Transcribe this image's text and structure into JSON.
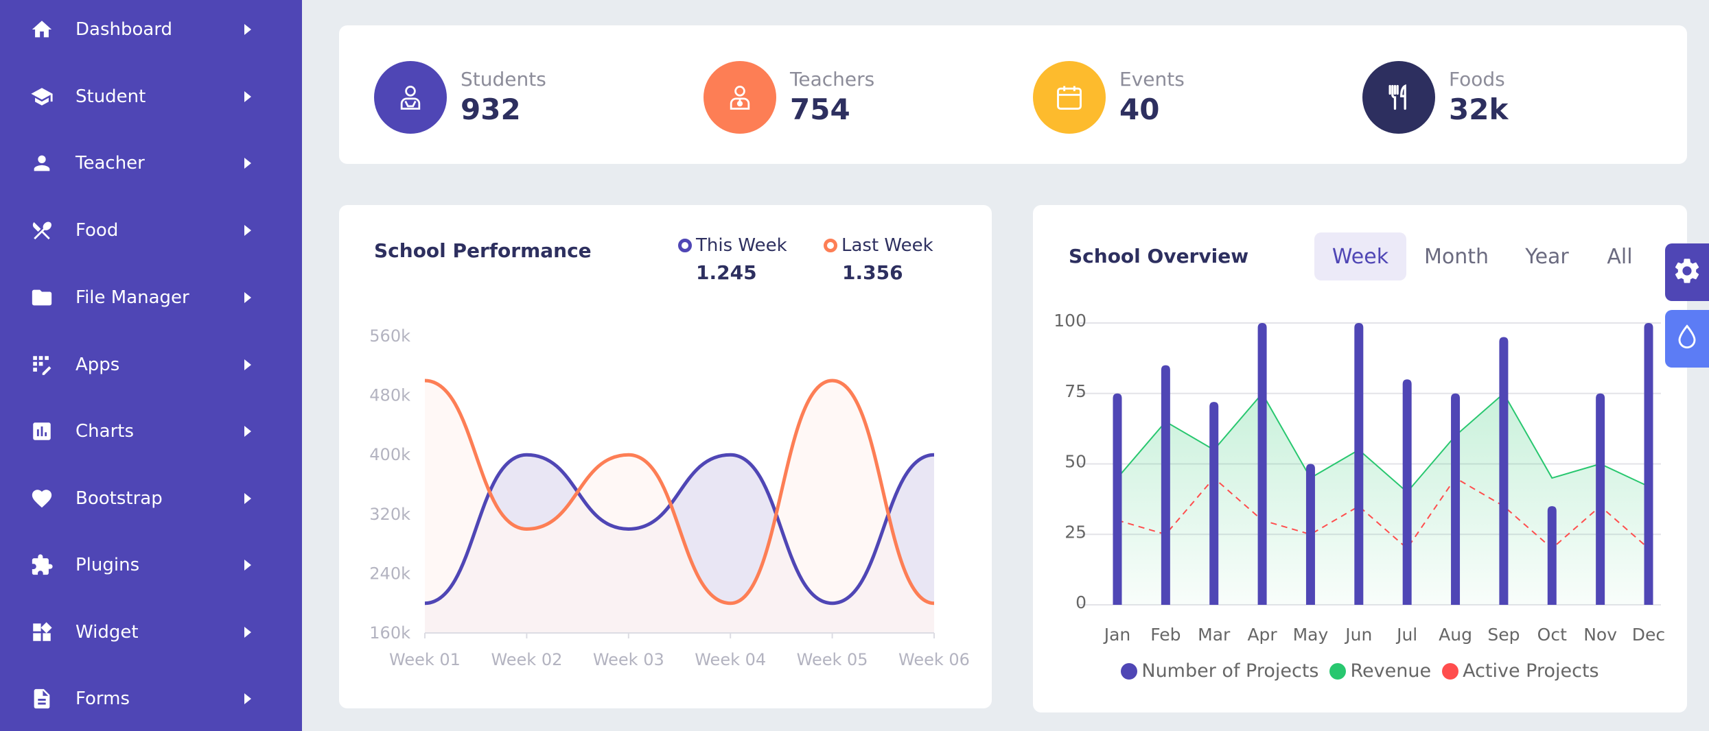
{
  "sidebar": {
    "items": [
      {
        "label": "Dashboard",
        "icon": "home-icon"
      },
      {
        "label": "Student",
        "icon": "graduation-cap-icon"
      },
      {
        "label": "Teacher",
        "icon": "person-icon"
      },
      {
        "label": "Food",
        "icon": "utensils-icon"
      },
      {
        "label": "File Manager",
        "icon": "folder-icon"
      },
      {
        "label": "Apps",
        "icon": "apps-icon"
      },
      {
        "label": "Charts",
        "icon": "bar-chart-icon"
      },
      {
        "label": "Bootstrap",
        "icon": "heart-icon"
      },
      {
        "label": "Plugins",
        "icon": "puzzle-icon"
      },
      {
        "label": "Widget",
        "icon": "widget-icon"
      },
      {
        "label": "Forms",
        "icon": "document-icon"
      }
    ]
  },
  "stats": [
    {
      "label": "Students",
      "value": "932",
      "color": "#4f46b5",
      "icon": "student-icon"
    },
    {
      "label": "Teachers",
      "value": "754",
      "color": "#fd7e55",
      "icon": "teacher-icon"
    },
    {
      "label": "Events",
      "value": "40",
      "color": "#fdbb2d",
      "icon": "calendar-icon"
    },
    {
      "label": "Foods",
      "value": "32k",
      "color": "#2d2f5f",
      "icon": "fork-knife-icon"
    }
  ],
  "performance": {
    "title": "School Performance",
    "legend": [
      {
        "label": "This Week",
        "value": "1.245",
        "color": "#4f46b5"
      },
      {
        "label": "Last Week",
        "value": "1.356",
        "color": "#fd7e55"
      }
    ]
  },
  "overview": {
    "title": "School Overview",
    "tabs": [
      "Week",
      "Month",
      "Year",
      "All"
    ],
    "active_tab": "Week",
    "legend": [
      {
        "label": "Number of Projects",
        "color": "#4f46b5"
      },
      {
        "label": "Revenue",
        "color": "#28c76f"
      },
      {
        "label": "Active Projects",
        "color": "#ff4d4d"
      }
    ]
  },
  "chart_data": [
    {
      "type": "area",
      "title": "School Performance",
      "categories": [
        "Week 01",
        "Week 02",
        "Week 03",
        "Week 04",
        "Week 05",
        "Week 06"
      ],
      "y_ticks": [
        "560k",
        "480k",
        "400k",
        "320k",
        "240k",
        "160k"
      ],
      "ylim": [
        160,
        560
      ],
      "series": [
        {
          "name": "This Week",
          "color": "#4f46b5",
          "values": [
            200,
            400,
            300,
            400,
            200,
            400
          ]
        },
        {
          "name": "Last Week",
          "color": "#fd7e55",
          "values": [
            500,
            300,
            400,
            200,
            500,
            200
          ]
        }
      ]
    },
    {
      "type": "bar",
      "title": "School Overview",
      "categories": [
        "Jan",
        "Feb",
        "Mar",
        "Apr",
        "May",
        "Jun",
        "Jul",
        "Aug",
        "Sep",
        "Oct",
        "Nov",
        "Dec"
      ],
      "y_ticks": [
        "100",
        "75",
        "50",
        "25",
        "0"
      ],
      "ylim": [
        0,
        100
      ],
      "series": [
        {
          "name": "Number of Projects",
          "type": "bar",
          "color": "#4f46b5",
          "values": [
            75,
            85,
            72,
            100,
            50,
            100,
            80,
            75,
            95,
            35,
            75,
            100
          ]
        },
        {
          "name": "Revenue",
          "type": "area",
          "color": "#28c76f",
          "values": [
            45,
            65,
            55,
            75,
            45,
            55,
            40,
            60,
            75,
            45,
            50,
            42
          ]
        },
        {
          "name": "Active Projects",
          "type": "line-dashed",
          "color": "#ff4d4d",
          "values": [
            30,
            25,
            45,
            30,
            25,
            35,
            20,
            45,
            35,
            20,
            35,
            20
          ]
        }
      ]
    }
  ],
  "floating": [
    {
      "icon": "gear-icon",
      "color": "#4f46b5"
    },
    {
      "icon": "droplet-icon",
      "color": "#5c7cf5"
    }
  ]
}
